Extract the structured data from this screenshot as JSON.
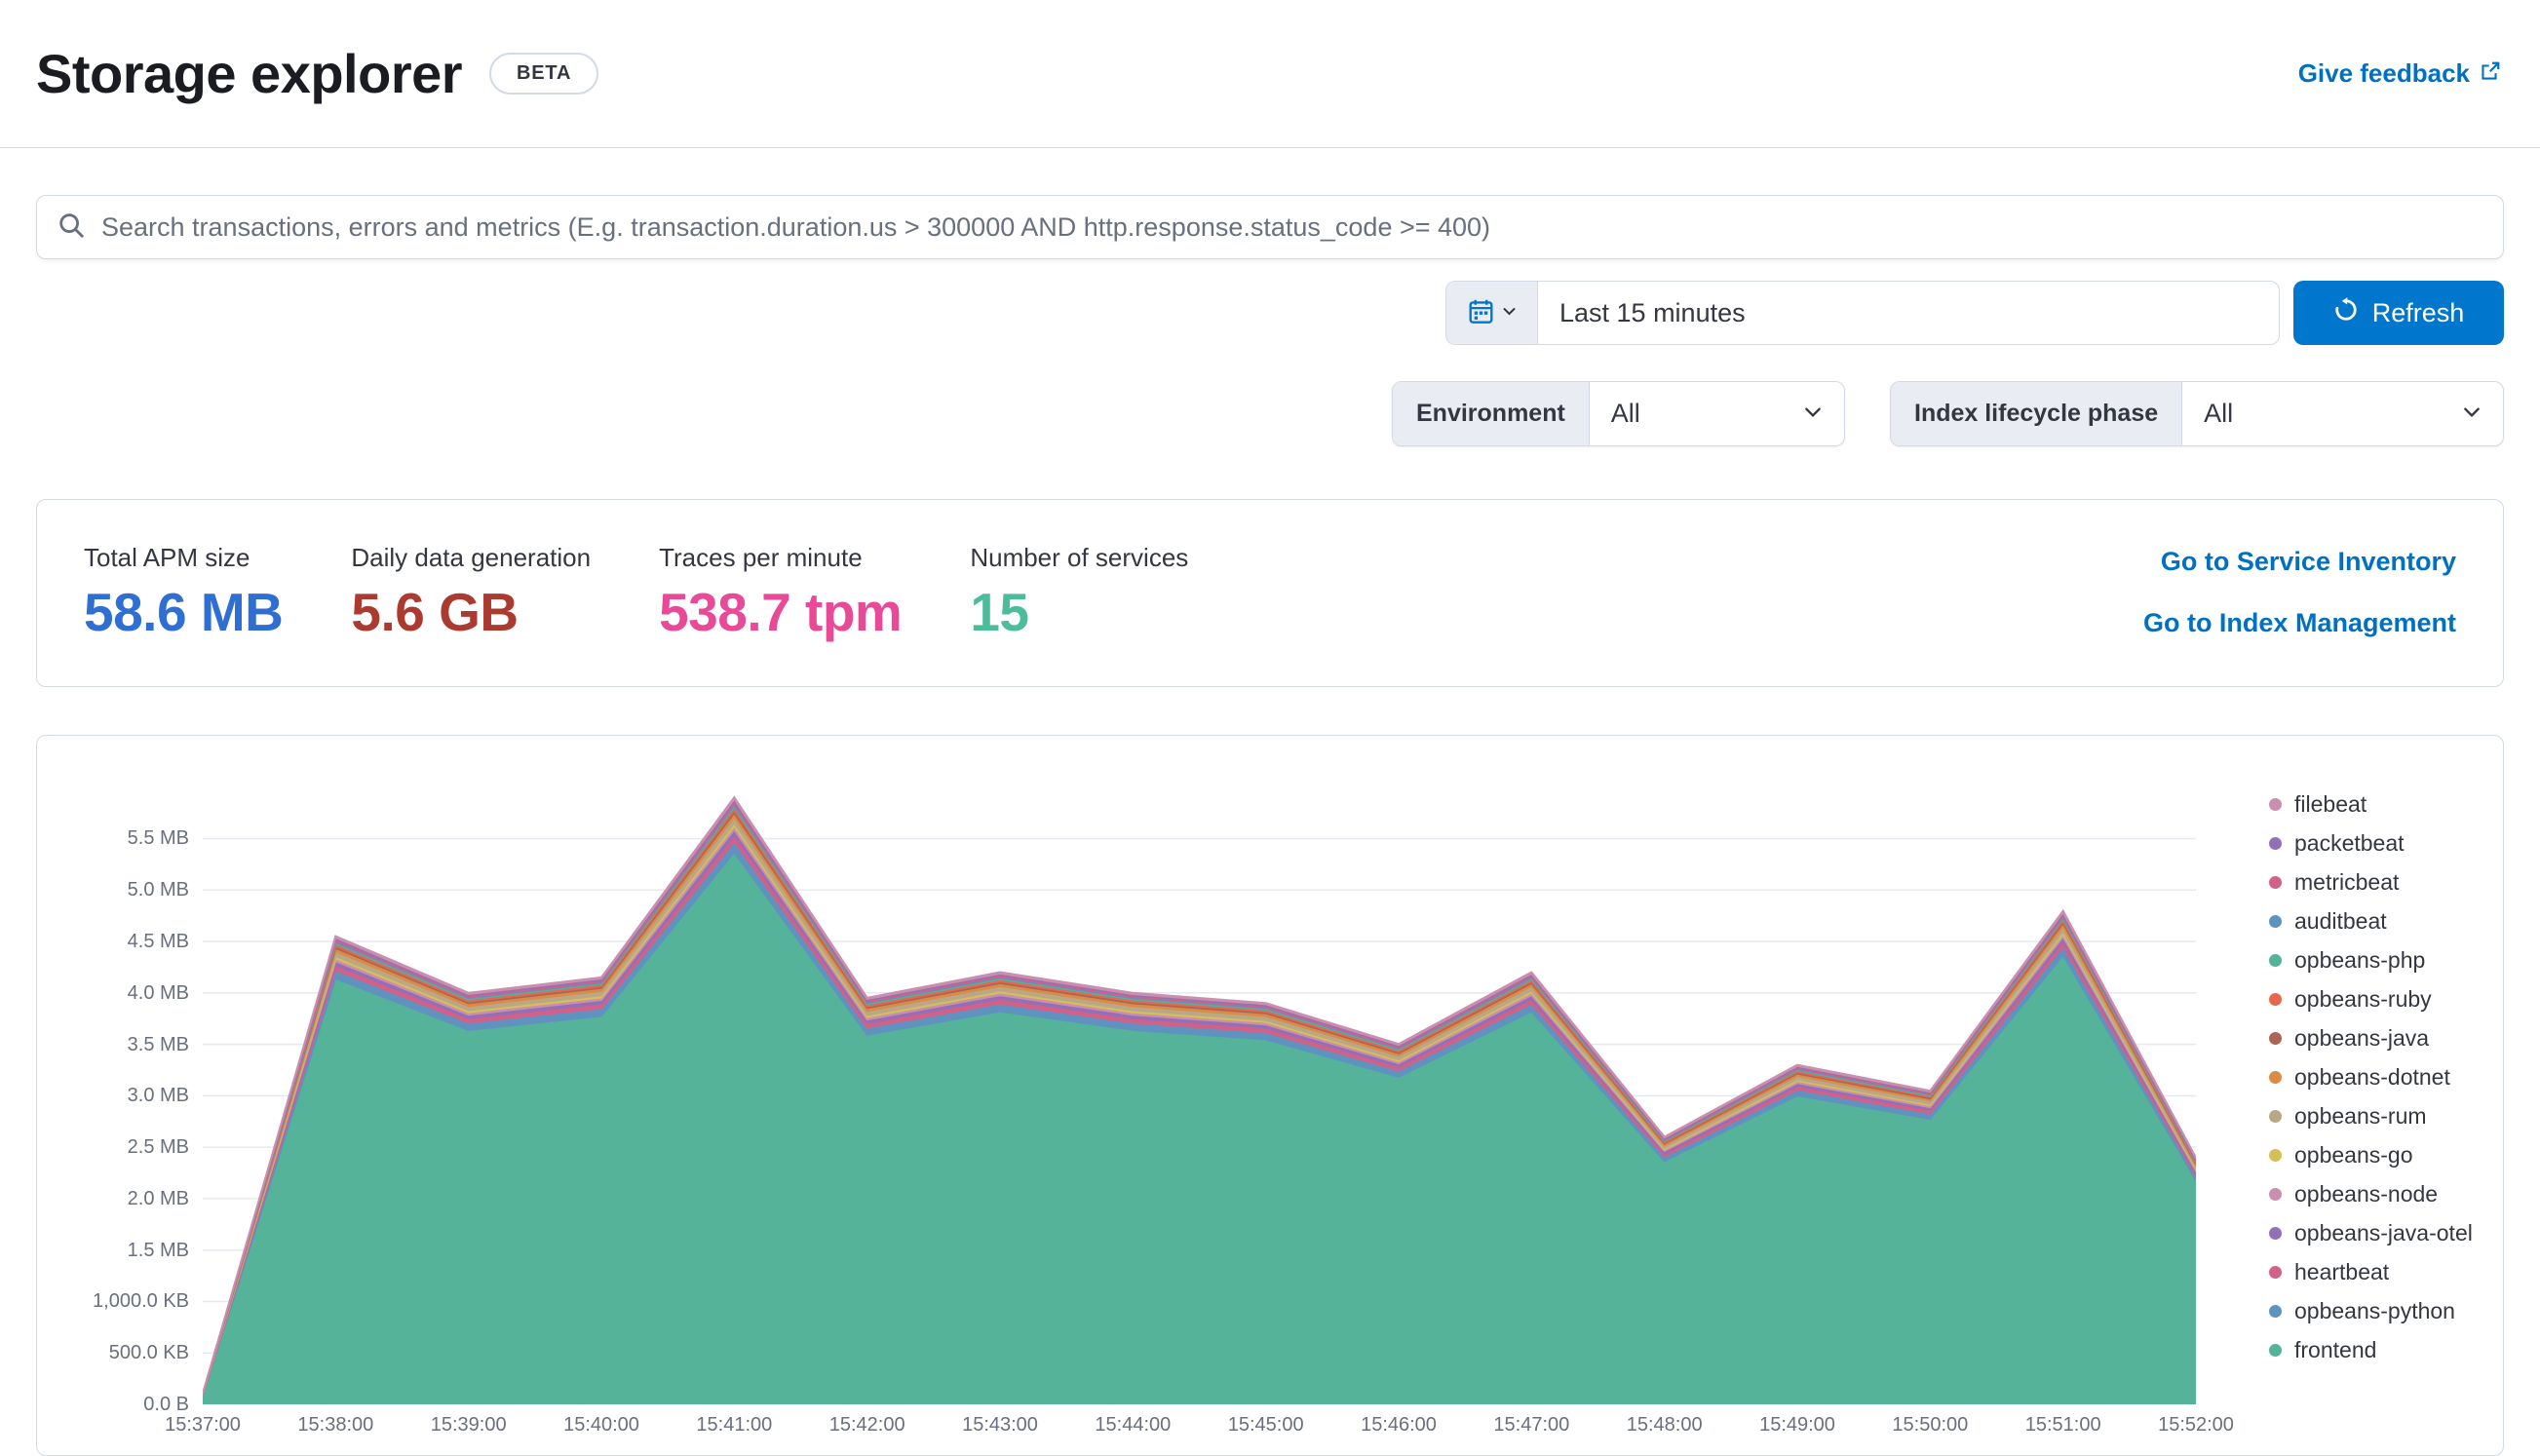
{
  "header": {
    "title": "Storage explorer",
    "badge": "BETA",
    "feedback_link": "Give feedback"
  },
  "search": {
    "placeholder": "Search transactions, errors and metrics (E.g. transaction.duration.us > 300000 AND http.response.status_code >= 400)"
  },
  "datepicker": {
    "value": "Last 15 minutes",
    "refresh_label": "Refresh"
  },
  "filters": {
    "environment_label": "Environment",
    "environment_value": "All",
    "ilm_label": "Index lifecycle phase",
    "ilm_value": "All"
  },
  "stats": {
    "items": [
      {
        "label": "Total APM size",
        "value": "58.6 MB",
        "color": "#2f6fd3"
      },
      {
        "label": "Daily data generation",
        "value": "5.6 GB",
        "color": "#ab3a30"
      },
      {
        "label": "Traces per minute",
        "value": "538.7 tpm",
        "color": "#e84a97"
      },
      {
        "label": "Number of services",
        "value": "15",
        "color": "#4cbd9a"
      }
    ],
    "links": [
      "Go to Service Inventory",
      "Go to Index Management"
    ]
  },
  "theme": {
    "primary_button": "#0077cc",
    "link": "#0071c2",
    "border": "#d3dae6"
  },
  "chart_data": {
    "type": "area",
    "stacked": true,
    "unit": "MB",
    "grid": true,
    "legend_position": "right",
    "x": [
      "15:37:00",
      "15:38:00",
      "15:39:00",
      "15:40:00",
      "15:41:00",
      "15:42:00",
      "15:43:00",
      "15:44:00",
      "15:45:00",
      "15:46:00",
      "15:47:00",
      "15:48:00",
      "15:49:00",
      "15:50:00",
      "15:51:00",
      "15:52:00"
    ],
    "ylim": [
      0,
      6.13
    ],
    "yticks": {
      "values": [
        0,
        0.5,
        1,
        1.5,
        2,
        2.5,
        3,
        3.5,
        4,
        4.5,
        5,
        5.5
      ],
      "labels": [
        "0.0 B",
        "500.0 KB",
        "1,000.0 KB",
        "1.5 MB",
        "2.0 MB",
        "2.5 MB",
        "3.0 MB",
        "3.5 MB",
        "4.0 MB",
        "4.5 MB",
        "5.0 MB",
        "5.5 MB"
      ]
    },
    "series": [
      {
        "name": "filebeat",
        "color": "#CA8EAE",
        "values": [
          0.0,
          0.014,
          0.012,
          0.012,
          0.018,
          0.012,
          0.013,
          0.012,
          0.012,
          0.011,
          0.013,
          0.008,
          0.01,
          0.009,
          0.014,
          0.007
        ]
      },
      {
        "name": "packetbeat",
        "color": "#9170B8",
        "values": [
          0.0,
          0.014,
          0.012,
          0.012,
          0.018,
          0.012,
          0.013,
          0.012,
          0.012,
          0.011,
          0.013,
          0.008,
          0.01,
          0.009,
          0.014,
          0.007
        ]
      },
      {
        "name": "metricbeat",
        "color": "#D36086",
        "values": [
          0.0,
          0.018,
          0.016,
          0.017,
          0.024,
          0.016,
          0.017,
          0.016,
          0.016,
          0.014,
          0.017,
          0.01,
          0.013,
          0.012,
          0.019,
          0.01
        ]
      },
      {
        "name": "auditbeat",
        "color": "#6092C0",
        "values": [
          0.0,
          0.014,
          0.012,
          0.012,
          0.018,
          0.012,
          0.013,
          0.012,
          0.012,
          0.011,
          0.013,
          0.008,
          0.01,
          0.009,
          0.014,
          0.007
        ]
      },
      {
        "name": "opbeans-php",
        "color": "#54B399",
        "values": [
          0.0,
          0.014,
          0.012,
          0.012,
          0.018,
          0.012,
          0.013,
          0.012,
          0.012,
          0.011,
          0.013,
          0.008,
          0.01,
          0.009,
          0.014,
          0.007
        ]
      },
      {
        "name": "opbeans-ruby",
        "color": "#E7664C",
        "values": [
          0.001,
          0.023,
          0.02,
          0.021,
          0.03,
          0.02,
          0.021,
          0.02,
          0.02,
          0.018,
          0.021,
          0.013,
          0.017,
          0.015,
          0.024,
          0.012
        ]
      },
      {
        "name": "opbeans-java",
        "color": "#AA6556",
        "values": [
          0.0,
          0.018,
          0.016,
          0.017,
          0.024,
          0.016,
          0.017,
          0.016,
          0.016,
          0.014,
          0.017,
          0.01,
          0.013,
          0.012,
          0.019,
          0.01
        ]
      },
      {
        "name": "opbeans-dotnet",
        "color": "#DA8B45",
        "values": [
          0.001,
          0.032,
          0.028,
          0.029,
          0.041,
          0.028,
          0.029,
          0.028,
          0.027,
          0.025,
          0.029,
          0.018,
          0.023,
          0.021,
          0.034,
          0.017
        ]
      },
      {
        "name": "opbeans-rum",
        "color": "#B9A888",
        "values": [
          0.001,
          0.046,
          0.04,
          0.042,
          0.059,
          0.04,
          0.042,
          0.04,
          0.039,
          0.035,
          0.042,
          0.026,
          0.033,
          0.031,
          0.048,
          0.024
        ]
      },
      {
        "name": "opbeans-go",
        "color": "#D6BF57",
        "values": [
          0.001,
          0.023,
          0.02,
          0.021,
          0.03,
          0.02,
          0.021,
          0.02,
          0.02,
          0.018,
          0.021,
          0.013,
          0.017,
          0.015,
          0.024,
          0.012
        ]
      },
      {
        "name": "opbeans-node",
        "color": "#CA8EAE",
        "values": [
          0.001,
          0.027,
          0.024,
          0.025,
          0.035,
          0.024,
          0.025,
          0.024,
          0.023,
          0.021,
          0.025,
          0.016,
          0.02,
          0.018,
          0.029,
          0.014
        ]
      },
      {
        "name": "opbeans-java-otel",
        "color": "#9170B8",
        "values": [
          0.001,
          0.036,
          0.032,
          0.033,
          0.047,
          0.032,
          0.034,
          0.032,
          0.031,
          0.028,
          0.034,
          0.021,
          0.026,
          0.024,
          0.038,
          0.019
        ]
      },
      {
        "name": "heartbeat",
        "color": "#D36086",
        "values": [
          0.001,
          0.05,
          0.044,
          0.046,
          0.065,
          0.043,
          0.046,
          0.044,
          0.043,
          0.039,
          0.046,
          0.029,
          0.036,
          0.034,
          0.053,
          0.026
        ]
      },
      {
        "name": "opbeans-python",
        "color": "#6092C0",
        "values": [
          0.002,
          0.082,
          0.072,
          0.075,
          0.106,
          0.071,
          0.076,
          0.072,
          0.07,
          0.063,
          0.076,
          0.047,
          0.059,
          0.055,
          0.086,
          0.043
        ]
      },
      {
        "name": "frontend",
        "color": "#54B399",
        "values": [
          0.091,
          4.141,
          3.64,
          3.777,
          5.369,
          3.595,
          3.822,
          3.64,
          3.549,
          3.185,
          3.822,
          2.366,
          3.003,
          2.776,
          4.368,
          2.184
        ]
      }
    ]
  }
}
